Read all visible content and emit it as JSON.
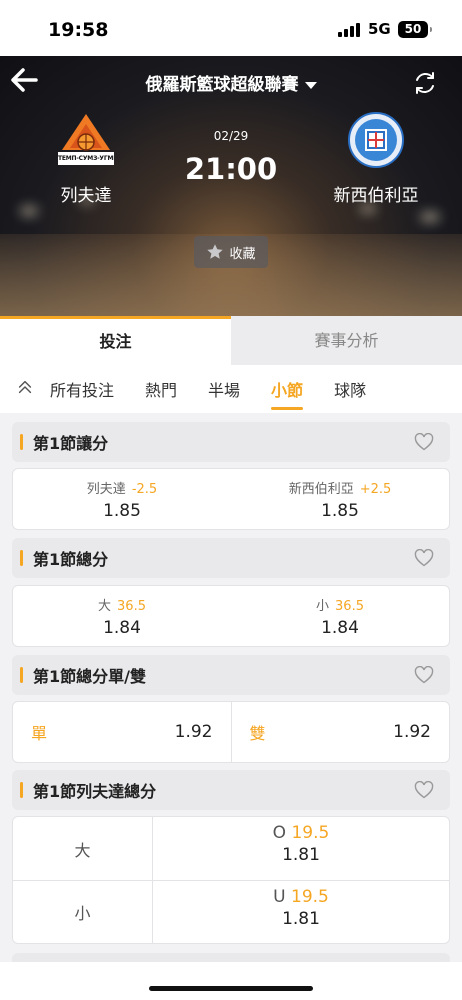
{
  "status_bar": {
    "time": "19:58",
    "network": "5G",
    "battery": "50"
  },
  "header": {
    "league": "俄羅斯籃球超級聯賽",
    "date": "02/29",
    "time": "21:00",
    "home_team": "列夫達",
    "away_team": "新西伯利亞",
    "home_logo_text": "ТЕМП-СУМЗ-УГМК",
    "favorite_label": "收藏"
  },
  "tabs": {
    "bet": "投注",
    "analysis": "賽事分析"
  },
  "subnav": [
    "所有投注",
    "熱門",
    "半場",
    "小節",
    "球隊"
  ],
  "markets": {
    "handicap": {
      "title": "第1節讓分",
      "home": {
        "name": "列夫達",
        "line": "-2.5",
        "odds": "1.85"
      },
      "away": {
        "name": "新西伯利亞",
        "line": "+2.5",
        "odds": "1.85"
      }
    },
    "total": {
      "title": "第1節總分",
      "over": {
        "name": "大",
        "line": "36.5",
        "odds": "1.84"
      },
      "under": {
        "name": "小",
        "line": "36.5",
        "odds": "1.84"
      }
    },
    "odd_even": {
      "title": "第1節總分單/雙",
      "odd": {
        "name": "單",
        "odds": "1.92"
      },
      "even": {
        "name": "雙",
        "odds": "1.92"
      }
    },
    "team_total": {
      "title": "第1節列夫達總分",
      "rows": [
        {
          "side": "大",
          "prefix": "O",
          "line": "19.5",
          "odds": "1.81"
        },
        {
          "side": "小",
          "prefix": "U",
          "line": "19.5",
          "odds": "1.81"
        }
      ]
    }
  },
  "colors": {
    "accent": "#f5a623",
    "header_bg": "#1a1a1f"
  }
}
